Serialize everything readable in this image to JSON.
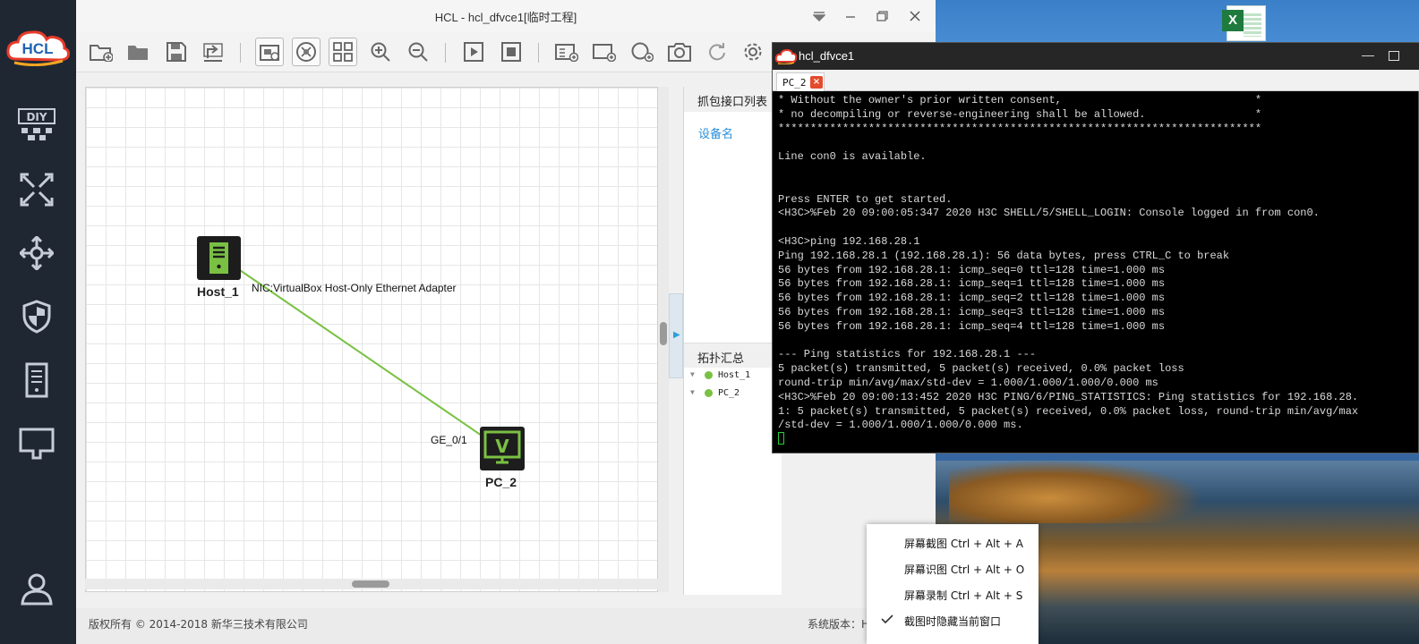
{
  "desktop": {
    "file_icon": "excel-file-icon"
  },
  "sidebar": {
    "logo_text": "HCL",
    "items": [
      {
        "icon": "diy-icon",
        "label": "DIY"
      },
      {
        "icon": "router-icon"
      },
      {
        "icon": "switch-icon"
      },
      {
        "icon": "firewall-shield-icon"
      },
      {
        "icon": "server-icon"
      },
      {
        "icon": "terminal-icon"
      },
      {
        "icon": "user-icon"
      }
    ]
  },
  "window": {
    "title": "HCL - hcl_dfvce1[临时工程]",
    "controls": [
      "menu-dropdown-icon",
      "minimize-icon",
      "maximize-icon",
      "close-icon"
    ]
  },
  "toolbar": {
    "icons": [
      "new-project-icon",
      "open-project-icon",
      "save-icon",
      "export-icon",
      "capture-topo-icon",
      "hide-labels-icon",
      "grid-icon",
      "zoom-in-icon",
      "zoom-out-icon",
      "start-icon",
      "stop-icon",
      "add-text-icon",
      "add-rectangle-icon",
      "add-ellipse-icon",
      "screenshot-icon",
      "undo-icon",
      "settings-icon"
    ]
  },
  "topology": {
    "devices": [
      {
        "name": "Host_1",
        "type": "host"
      },
      {
        "name": "PC_2",
        "type": "pc",
        "glyph": "V"
      }
    ],
    "links": [
      {
        "from": "Host_1",
        "to": "PC_2",
        "from_label": "NIC:VirtualBox Host-Only Ethernet Adapter",
        "to_label": "GE_0/1",
        "color": "#7ac143"
      }
    ]
  },
  "capture_panel": {
    "title": "抓包接口列表",
    "column": "设备名"
  },
  "topo_summary": {
    "title": "拓扑汇总",
    "items": [
      {
        "label": "Host_1",
        "status_color": "#7ac143"
      },
      {
        "label": "PC_2",
        "status_color": "#7ac143"
      }
    ]
  },
  "statusbar": {
    "copyright": "版权所有 © 2014-2018 新华三技术有限公司",
    "version_label": "系统版本：H"
  },
  "console": {
    "title": "hcl_dfvce1",
    "tab": "PC_2",
    "lines": [
      "* Without the owner's prior written consent,                              *",
      "* no decompiling or reverse-engineering shall be allowed.                 *",
      "***************************************************************************",
      "",
      "Line con0 is available.",
      "",
      "",
      "Press ENTER to get started.",
      "<H3C>%Feb 20 09:00:05:347 2020 H3C SHELL/5/SHELL_LOGIN: Console logged in from con0.",
      "",
      "<H3C>ping 192.168.28.1",
      "Ping 192.168.28.1 (192.168.28.1): 56 data bytes, press CTRL_C to break",
      "56 bytes from 192.168.28.1: icmp_seq=0 ttl=128 time=1.000 ms",
      "56 bytes from 192.168.28.1: icmp_seq=1 ttl=128 time=1.000 ms",
      "56 bytes from 192.168.28.1: icmp_seq=2 ttl=128 time=1.000 ms",
      "56 bytes from 192.168.28.1: icmp_seq=3 ttl=128 time=1.000 ms",
      "56 bytes from 192.168.28.1: icmp_seq=4 ttl=128 time=1.000 ms",
      "",
      "--- Ping statistics for 192.168.28.1 ---",
      "5 packet(s) transmitted, 5 packet(s) received, 0.0% packet loss",
      "round-trip min/avg/max/std-dev = 1.000/1.000/1.000/0.000 ms",
      "<H3C>%Feb 20 09:00:13:452 2020 H3C PING/6/PING_STATISTICS: Ping statistics for 192.168.28.",
      "1: 5 packet(s) transmitted, 5 packet(s) received, 0.0% packet loss, round-trip min/avg/max",
      "/std-dev = 1.000/1.000/1.000/0.000 ms."
    ]
  },
  "context_menu": {
    "items": [
      {
        "label": "屏幕截图 Ctrl + Alt + A",
        "checked": false
      },
      {
        "label": "屏幕识图 Ctrl + Alt + O",
        "checked": false
      },
      {
        "label": "屏幕录制 Ctrl + Alt + S",
        "checked": false
      },
      {
        "label": "截图时隐藏当前窗口",
        "checked": true
      }
    ]
  }
}
